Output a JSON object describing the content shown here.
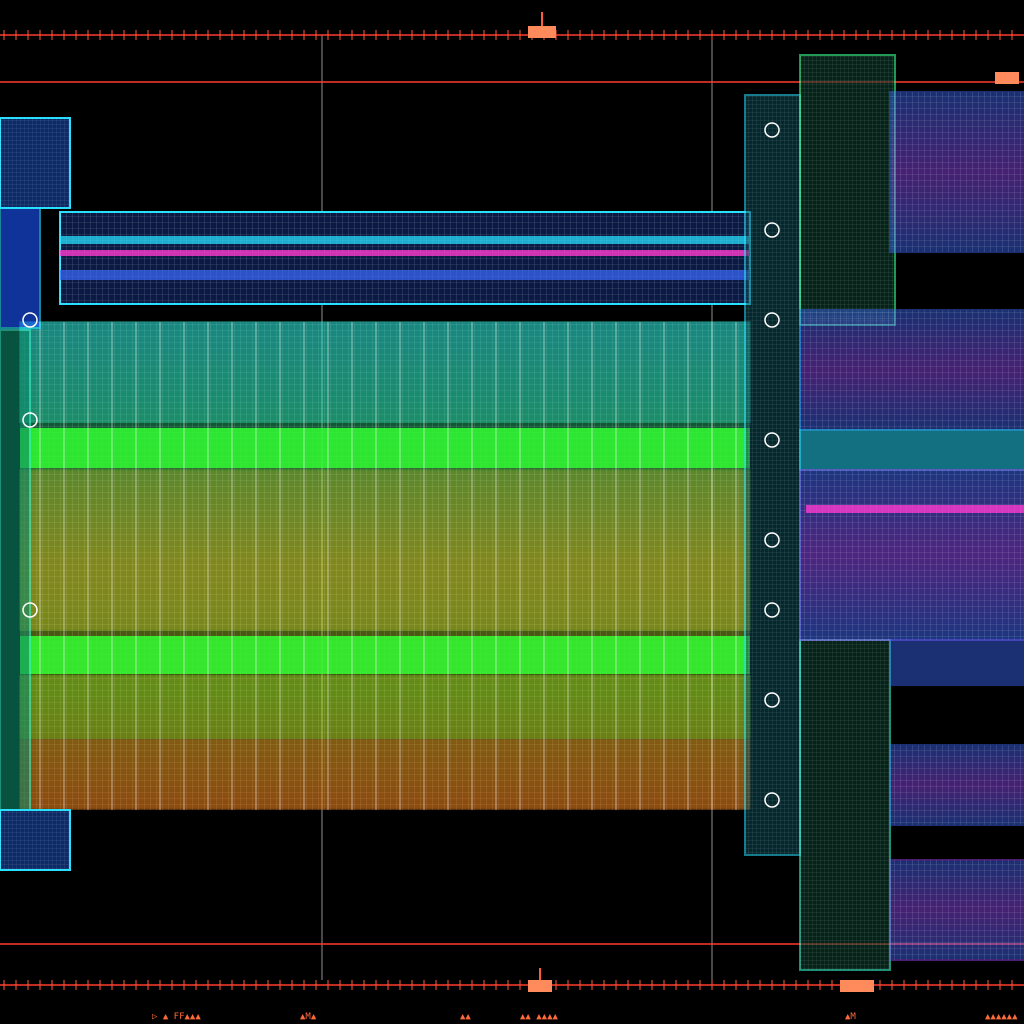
{
  "diagram": {
    "palette": {
      "background": "#000000",
      "ruler": "#ff3b2f",
      "ruler_tick": "#ff5a3c",
      "marker_fill": "#ff8a5c",
      "guide_line": "#cfcfcf",
      "blue": "#3a6bff",
      "cyan": "#27e0ff",
      "teal": "#32f0c8",
      "green": "#33ff33",
      "lime": "#b6ff2a",
      "yellow": "#f4ff3a",
      "orange": "#ff8a1e",
      "magenta": "#ff3ad0",
      "violet": "#9b4bff"
    },
    "icons": {
      "ruler_marker": "ruler-marker-icon",
      "gear_flange": "gear-flange-icon",
      "bolt": "bolt-icon"
    },
    "bottom_labels": [
      "▷ ▲ FF▲▲▲",
      "▲M▲",
      "▲▲",
      "▲▲ ▲▲▲▲",
      "▲M",
      "▲▲▲▲▲▲"
    ]
  }
}
